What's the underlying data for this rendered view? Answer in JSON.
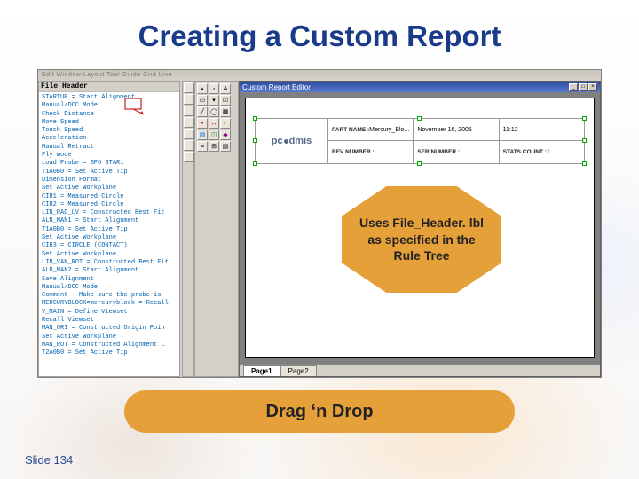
{
  "title": "Creating a Custom Report",
  "slide_label": "Slide 134",
  "dragdrop_label": "Drag ‘n Drop",
  "callout_text": "Uses File_Header. lbl as specified in the Rule Tree",
  "menubar_text": "Edit  Window  Layout  Tool  Guide  Grid  Line",
  "tree_header": "File Header",
  "tree_lines": [
    "STARTUP = Start Alignment",
    "Manual/DCC Mode",
    "Check Distance",
    "Move Speed",
    "Touch Speed",
    "Acceleration",
    "Manual Retract",
    "Fly mode",
    "Load Probe = SP6 STAR1",
    "T1A0B0 = Set Active Tip",
    "Dimension Format",
    "Set Active Workplane",
    "CIR1 = Measured Circle",
    "CIR2 = Measured Circle",
    "LIN_RAD_LV = Constructed Best Fit",
    "ALN_MAN1 = Start Alignment",
    "T1A0B0 = Set Active Tip",
    "Set Active Workplane",
    "CIR3 = CIRCLE (CONTACT)",
    "Set Active Workplane",
    "LIN_VAN_ROT = Constructed Best Fit",
    "ALN_MAN2 = Start Alignment",
    "Save Alignment",
    "Manual/DCC Mode",
    "Comment - Make sure the probe is",
    "MERCURYBLOCK=mercuryblock = Recall",
    "V_MAIN = Define Viewset",
    "Recall Viewset",
    "MAN_ORI = Constructed Origin Poin",
    "Set Active Workplane",
    "MAN_ROT = Constructed Alignment L",
    "T2A0B0 = Set Active Tip"
  ],
  "editor_title": "Custom Report Editor",
  "logo_left": "pc",
  "logo_right": "dmis",
  "header_rows": [
    [
      {
        "label": "PART NAME :",
        "value": "Mercury_Blo..."
      },
      {
        "label": "",
        "value": "November 16, 2005"
      },
      {
        "label": "",
        "value": "11:12"
      }
    ],
    [
      {
        "label": "REV NUMBER :",
        "value": ""
      },
      {
        "label": "SER NUMBER :",
        "value": ""
      },
      {
        "label": "STATS COUNT :",
        "value": "1"
      }
    ]
  ],
  "tabs": [
    "Page1",
    "Page2"
  ],
  "active_tab": 0,
  "toolbox_icons": [
    [
      "ptr",
      "sel",
      "txt"
    ],
    [
      "rect",
      "combo",
      "chk"
    ],
    [
      "line",
      "circ",
      "tbl"
    ],
    [
      "pt",
      "dim",
      "gauge"
    ],
    [
      "img",
      "graph",
      "cad"
    ],
    [
      "hdr",
      "ole",
      "lbl"
    ]
  ],
  "vtool_icons": [
    "arrow",
    "hand",
    "zoom",
    "text",
    "line",
    "rect",
    "mark"
  ],
  "win_buttons": [
    "_",
    "□",
    "×"
  ]
}
